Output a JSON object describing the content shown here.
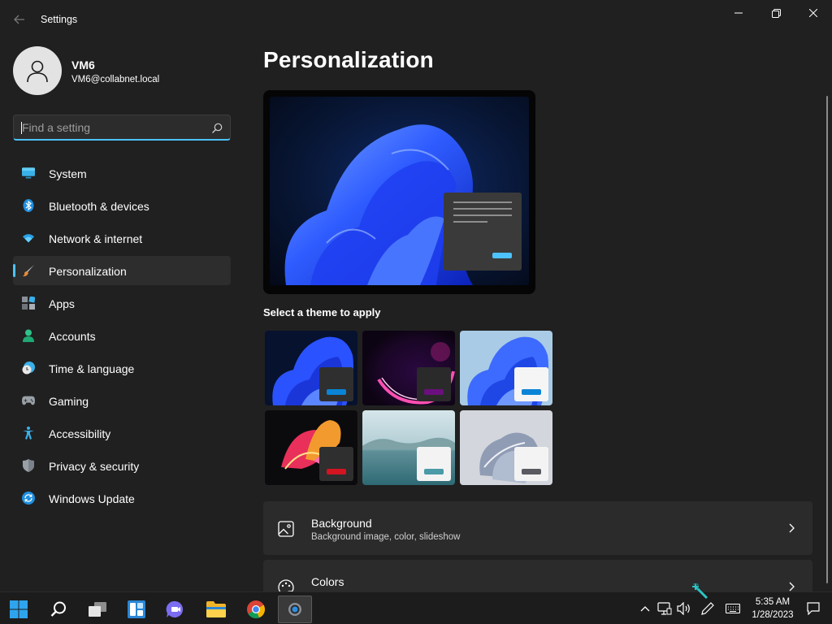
{
  "window": {
    "title": "Settings"
  },
  "user": {
    "name": "VM6",
    "email": "VM6@collabnet.local"
  },
  "search": {
    "placeholder": "Find a setting",
    "value": ""
  },
  "nav": [
    {
      "label": "System",
      "icon": "monitor-icon"
    },
    {
      "label": "Bluetooth & devices",
      "icon": "bluetooth-icon"
    },
    {
      "label": "Network & internet",
      "icon": "wifi-icon"
    },
    {
      "label": "Personalization",
      "icon": "brush-icon",
      "selected": true
    },
    {
      "label": "Apps",
      "icon": "apps-icon"
    },
    {
      "label": "Accounts",
      "icon": "person-icon"
    },
    {
      "label": "Time & language",
      "icon": "clock-globe-icon"
    },
    {
      "label": "Gaming",
      "icon": "gamepad-icon"
    },
    {
      "label": "Accessibility",
      "icon": "accessibility-icon"
    },
    {
      "label": "Privacy & security",
      "icon": "shield-icon"
    },
    {
      "label": "Windows Update",
      "icon": "update-icon"
    }
  ],
  "page": {
    "title": "Personalization",
    "themes_label": "Select a theme to apply",
    "themes": [
      {
        "name": "windows-dark",
        "accent": "#0a84d6"
      },
      {
        "name": "glow",
        "accent": "#6b0f7e"
      },
      {
        "name": "windows-light",
        "accent": "#0a84d6"
      },
      {
        "name": "captured-motion",
        "accent": "#d31421"
      },
      {
        "name": "sunrise",
        "accent": "#4a9aa8"
      },
      {
        "name": "flow",
        "accent": "#5a5a62"
      }
    ],
    "cards": [
      {
        "title": "Background",
        "subtitle": "Background image, color, slideshow",
        "icon": "image-icon"
      },
      {
        "title": "Colors",
        "subtitle": "",
        "icon": "palette-icon"
      }
    ]
  },
  "taskbar": {
    "apps": [
      "start-icon",
      "search-icon",
      "task-view-icon",
      "widgets-icon",
      "chat-icon",
      "file-explorer-icon",
      "chrome-icon",
      "settings-icon"
    ],
    "tray": [
      "chevron-up-icon",
      "network-icon",
      "volume-icon",
      "pen-icon",
      "keyboard-icon",
      "notification-icon"
    ],
    "time": "5:35 AM",
    "date": "1/28/2023"
  },
  "colors": {
    "accent": "#4cc2ff",
    "background": "#202020",
    "card": "#2b2b2b",
    "taskbar": "#1c1c1c"
  }
}
